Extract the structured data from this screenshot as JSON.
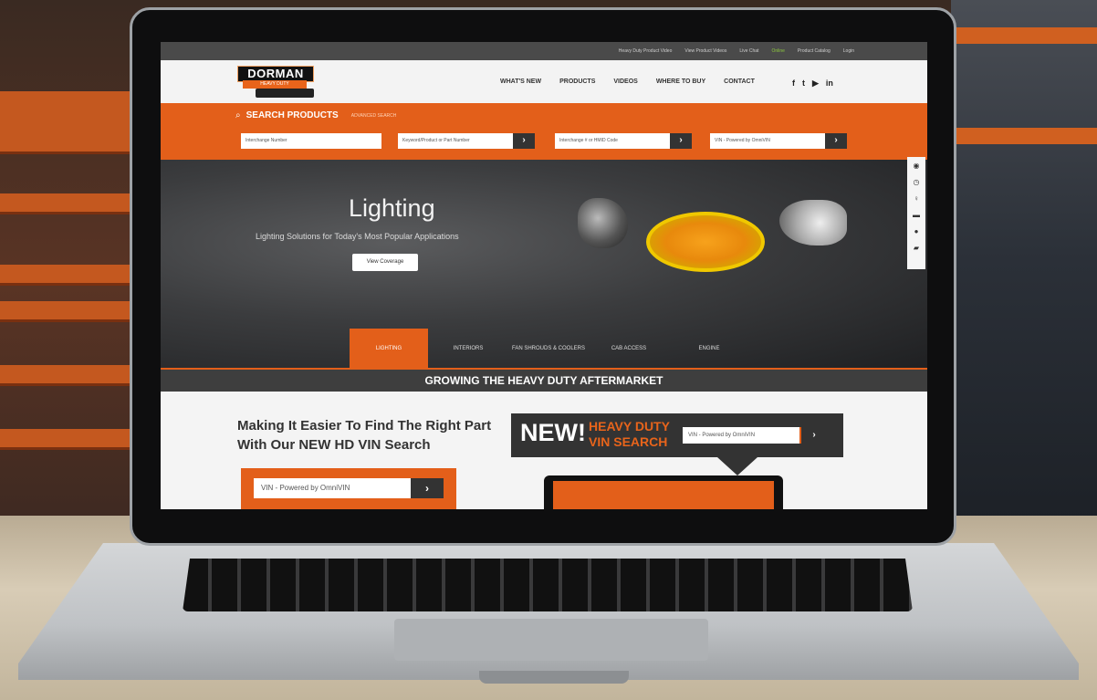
{
  "topbar": {
    "links": [
      "Heavy Duty Product Video",
      "View Product Videos",
      "Live Chat",
      "Online",
      "Product Catalog",
      "Login"
    ]
  },
  "header": {
    "logo": "DORMAN",
    "logo_sub": "HEAVY DUTY",
    "nav": [
      "WHAT'S NEW",
      "PRODUCTS",
      "VIDEOS",
      "WHERE TO BUY",
      "CONTACT"
    ],
    "social_icons": [
      "facebook-icon",
      "twitter-icon",
      "youtube-icon",
      "linkedin-icon"
    ]
  },
  "search": {
    "icon": "search-icon",
    "title": "SEARCH PRODUCTS",
    "advanced": "ADVANCED SEARCH",
    "fields": [
      {
        "placeholder": "Interchange Number"
      },
      {
        "placeholder": "Keyword/Product or Part Number"
      },
      {
        "placeholder": "Interchange # or HMID Code"
      },
      {
        "placeholder": "VIN - Powered by OmniVIN"
      }
    ],
    "go_label": "›"
  },
  "hero": {
    "title": "Lighting",
    "subtitle": "Lighting Solutions for Today's Most Popular Applications",
    "button": "View Coverage",
    "tabs": [
      "LIGHTING",
      "INTERIORS",
      "FAN SHROUDS & COOLERS",
      "CAB ACCESS",
      "ENGINE"
    ],
    "active_tab": "LIGHTING"
  },
  "sidebar_icons": [
    "new-icon",
    "clock-icon",
    "lightbulb-icon",
    "truck-icon",
    "chat-icon",
    "comment-icon"
  ],
  "banner": "GROWING THE HEAVY DUTY AFTERMARKET",
  "promo": {
    "headline": "Making It Easier To Find The Right Part With Our NEW HD VIN Search",
    "vin_placeholder": "VIN - Powered by OmniVIN",
    "new_label": "NEW!",
    "hd_label": "HEAVY DUTY VIN SEARCH",
    "banner_vin_placeholder": "VIN - Powered by OmniVIN"
  },
  "colors": {
    "accent": "#e35f1a",
    "dark": "#333333",
    "topbar": "#4a4a4a"
  }
}
